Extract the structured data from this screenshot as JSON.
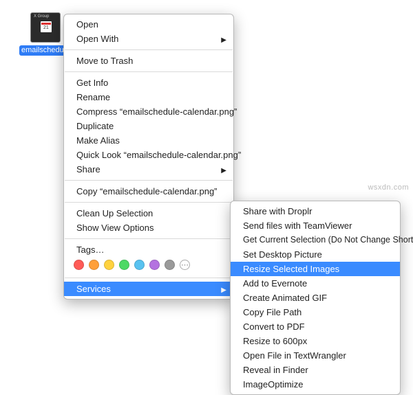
{
  "file": {
    "name": "emailschedule-calendar.p",
    "thumb_header": "X Group",
    "thumb_day": "21"
  },
  "menu": {
    "open": "Open",
    "open_with": "Open With",
    "trash": "Move to Trash",
    "get_info": "Get Info",
    "rename": "Rename",
    "compress": "Compress “emailschedule-calendar.png”",
    "duplicate": "Duplicate",
    "make_alias": "Make Alias",
    "quick_look": "Quick Look “emailschedule-calendar.png”",
    "share": "Share",
    "copy": "Copy “emailschedule-calendar.png”",
    "clean_up": "Clean Up Selection",
    "view_options": "Show View Options",
    "tags": "Tags…",
    "services": "Services"
  },
  "tag_colors": [
    "#ff5b57",
    "#ff9f39",
    "#ffd23f",
    "#4dd964",
    "#59c2f0",
    "#b472e0",
    "#9a9a9a"
  ],
  "sub": {
    "droplr": "Share with Droplr",
    "teamviewer": "Send files with TeamViewer",
    "get_sel": "Get Current Selection (Do Not Change Shortcut)",
    "desktop": "Set Desktop Picture",
    "resize": "Resize Selected Images",
    "evernote": "Add to Evernote",
    "gif": "Create Animated GIF",
    "copy_path": "Copy File Path",
    "pdf": "Convert to PDF",
    "resize600": "Resize to 600px",
    "textwrangler": "Open File in TextWrangler",
    "reveal": "Reveal in Finder",
    "optimize": "ImageOptimize"
  },
  "watermark": "wsxdn.com"
}
